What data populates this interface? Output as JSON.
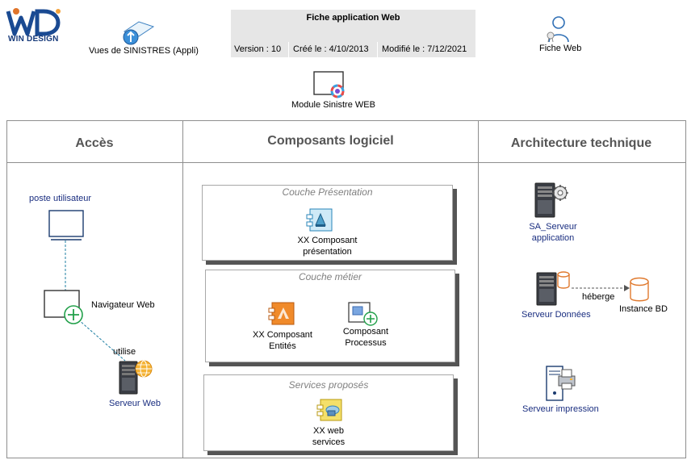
{
  "header": {
    "logo_text": "WIN DESIGN",
    "title": "Fiche application Web",
    "version": "Version : 10",
    "created": "Créé le : 4/10/2013",
    "modified": "Modifié le : 7/12/2021"
  },
  "top_items": {
    "vues": "Vues de SINISTRES (Appli)",
    "fiche_web": "Fiche Web",
    "module": "Module Sinistre WEB"
  },
  "columns": {
    "acces": "Accès",
    "composants": "Composants logiciel",
    "architecture": "Architecture technique"
  },
  "acces": {
    "poste": "poste utilisateur",
    "navigateur": "Navigateur Web",
    "utilise": "utilise",
    "serveur_web": "Serveur Web"
  },
  "layers": {
    "presentation": {
      "title": "Couche Présentation",
      "component_line1": "XX Composant",
      "component_line2": "présentation"
    },
    "metier": {
      "title": "Couche métier",
      "entites_line1": "XX Composant",
      "entites_line2": "Entités",
      "processus_line1": "Composant",
      "processus_line2": "Processus"
    },
    "services": {
      "title": "Services proposés",
      "component_line1": "XX web",
      "component_line2": "services"
    }
  },
  "architecture": {
    "sa_line1": "SA_Serveur",
    "sa_line2": "application",
    "serveur_donnees": "Serveur Données",
    "heberge": "héberge",
    "instance_bd": "Instance BD",
    "serveur_impression": "Serveur impression"
  },
  "colors": {
    "frame": "#8e8e8e",
    "label_blue": "#1a2e80",
    "header_bg": "#e6e6e6",
    "connector": "#1f7fa3",
    "plus_green": "#22a04a",
    "db_orange": "#e07a2f"
  }
}
